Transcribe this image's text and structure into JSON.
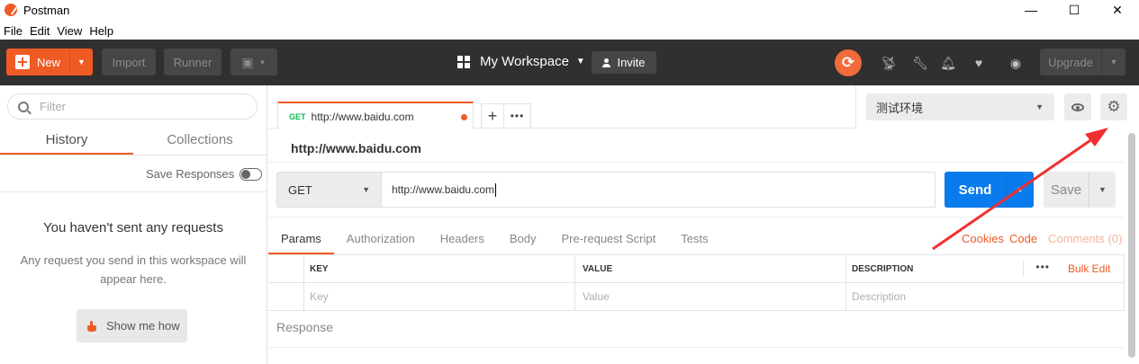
{
  "window": {
    "title": "Postman",
    "minimize": "—",
    "maximize": "☐",
    "close": "✕"
  },
  "menu": [
    "File",
    "Edit",
    "View",
    "Help"
  ],
  "header": {
    "new_label": "New",
    "import_label": "Import",
    "runner_label": "Runner",
    "workspace_label": "My Workspace",
    "invite_label": "Invite",
    "upgrade_label": "Upgrade"
  },
  "sidebar": {
    "filter_placeholder": "Filter",
    "tabs": [
      "History",
      "Collections"
    ],
    "active_tab": "History",
    "save_responses_label": "Save Responses",
    "empty_title": "You haven't sent any requests",
    "empty_desc": "Any request you send in this workspace will appear here.",
    "show_me_label": "Show me how"
  },
  "request_tab": {
    "method": "GET",
    "url": "http://www.baidu.com"
  },
  "environment": {
    "selected": "测试环境"
  },
  "request": {
    "name": "http://www.baidu.com",
    "method": "GET",
    "url": "http://www.baidu.com",
    "send_label": "Send",
    "save_label": "Save"
  },
  "request_tabs": [
    "Params",
    "Authorization",
    "Headers",
    "Body",
    "Pre-request Script",
    "Tests"
  ],
  "request_links": {
    "cookies": "Cookies",
    "code": "Code",
    "comments": "Comments (0)"
  },
  "params_table": {
    "headers": [
      "KEY",
      "VALUE",
      "DESCRIPTION"
    ],
    "placeholders": [
      "Key",
      "Value",
      "Description"
    ],
    "bulk_edit_label": "Bulk Edit"
  },
  "response_label": "Response",
  "colors": {
    "accent": "#ef5b25",
    "send": "#097bed",
    "header_bg": "#303030",
    "annotation_arrow": "#f03030"
  }
}
